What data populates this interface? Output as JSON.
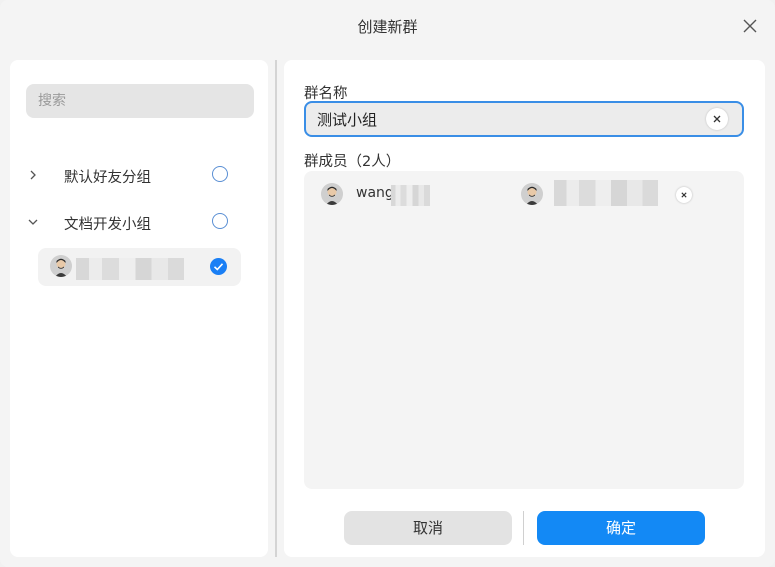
{
  "dialog": {
    "title": "创建新群"
  },
  "left": {
    "search_placeholder": "搜索",
    "groups": [
      {
        "label": "默认好友分组",
        "expanded": false,
        "selected": false
      },
      {
        "label": "文档开发小组",
        "expanded": true,
        "selected": false
      }
    ],
    "members": [
      {
        "name": "",
        "selected": true
      }
    ]
  },
  "right": {
    "name_label": "群名称",
    "name_value": "测试小组",
    "members_label": "群成员（2人）",
    "members": [
      {
        "name": "wang"
      },
      {
        "name": ""
      }
    ]
  },
  "buttons": {
    "cancel": "取消",
    "ok": "确定"
  },
  "colors": {
    "accent": "#1389f5",
    "focus_border": "#3a8ee6",
    "radio_border": "#5a8fd4"
  }
}
